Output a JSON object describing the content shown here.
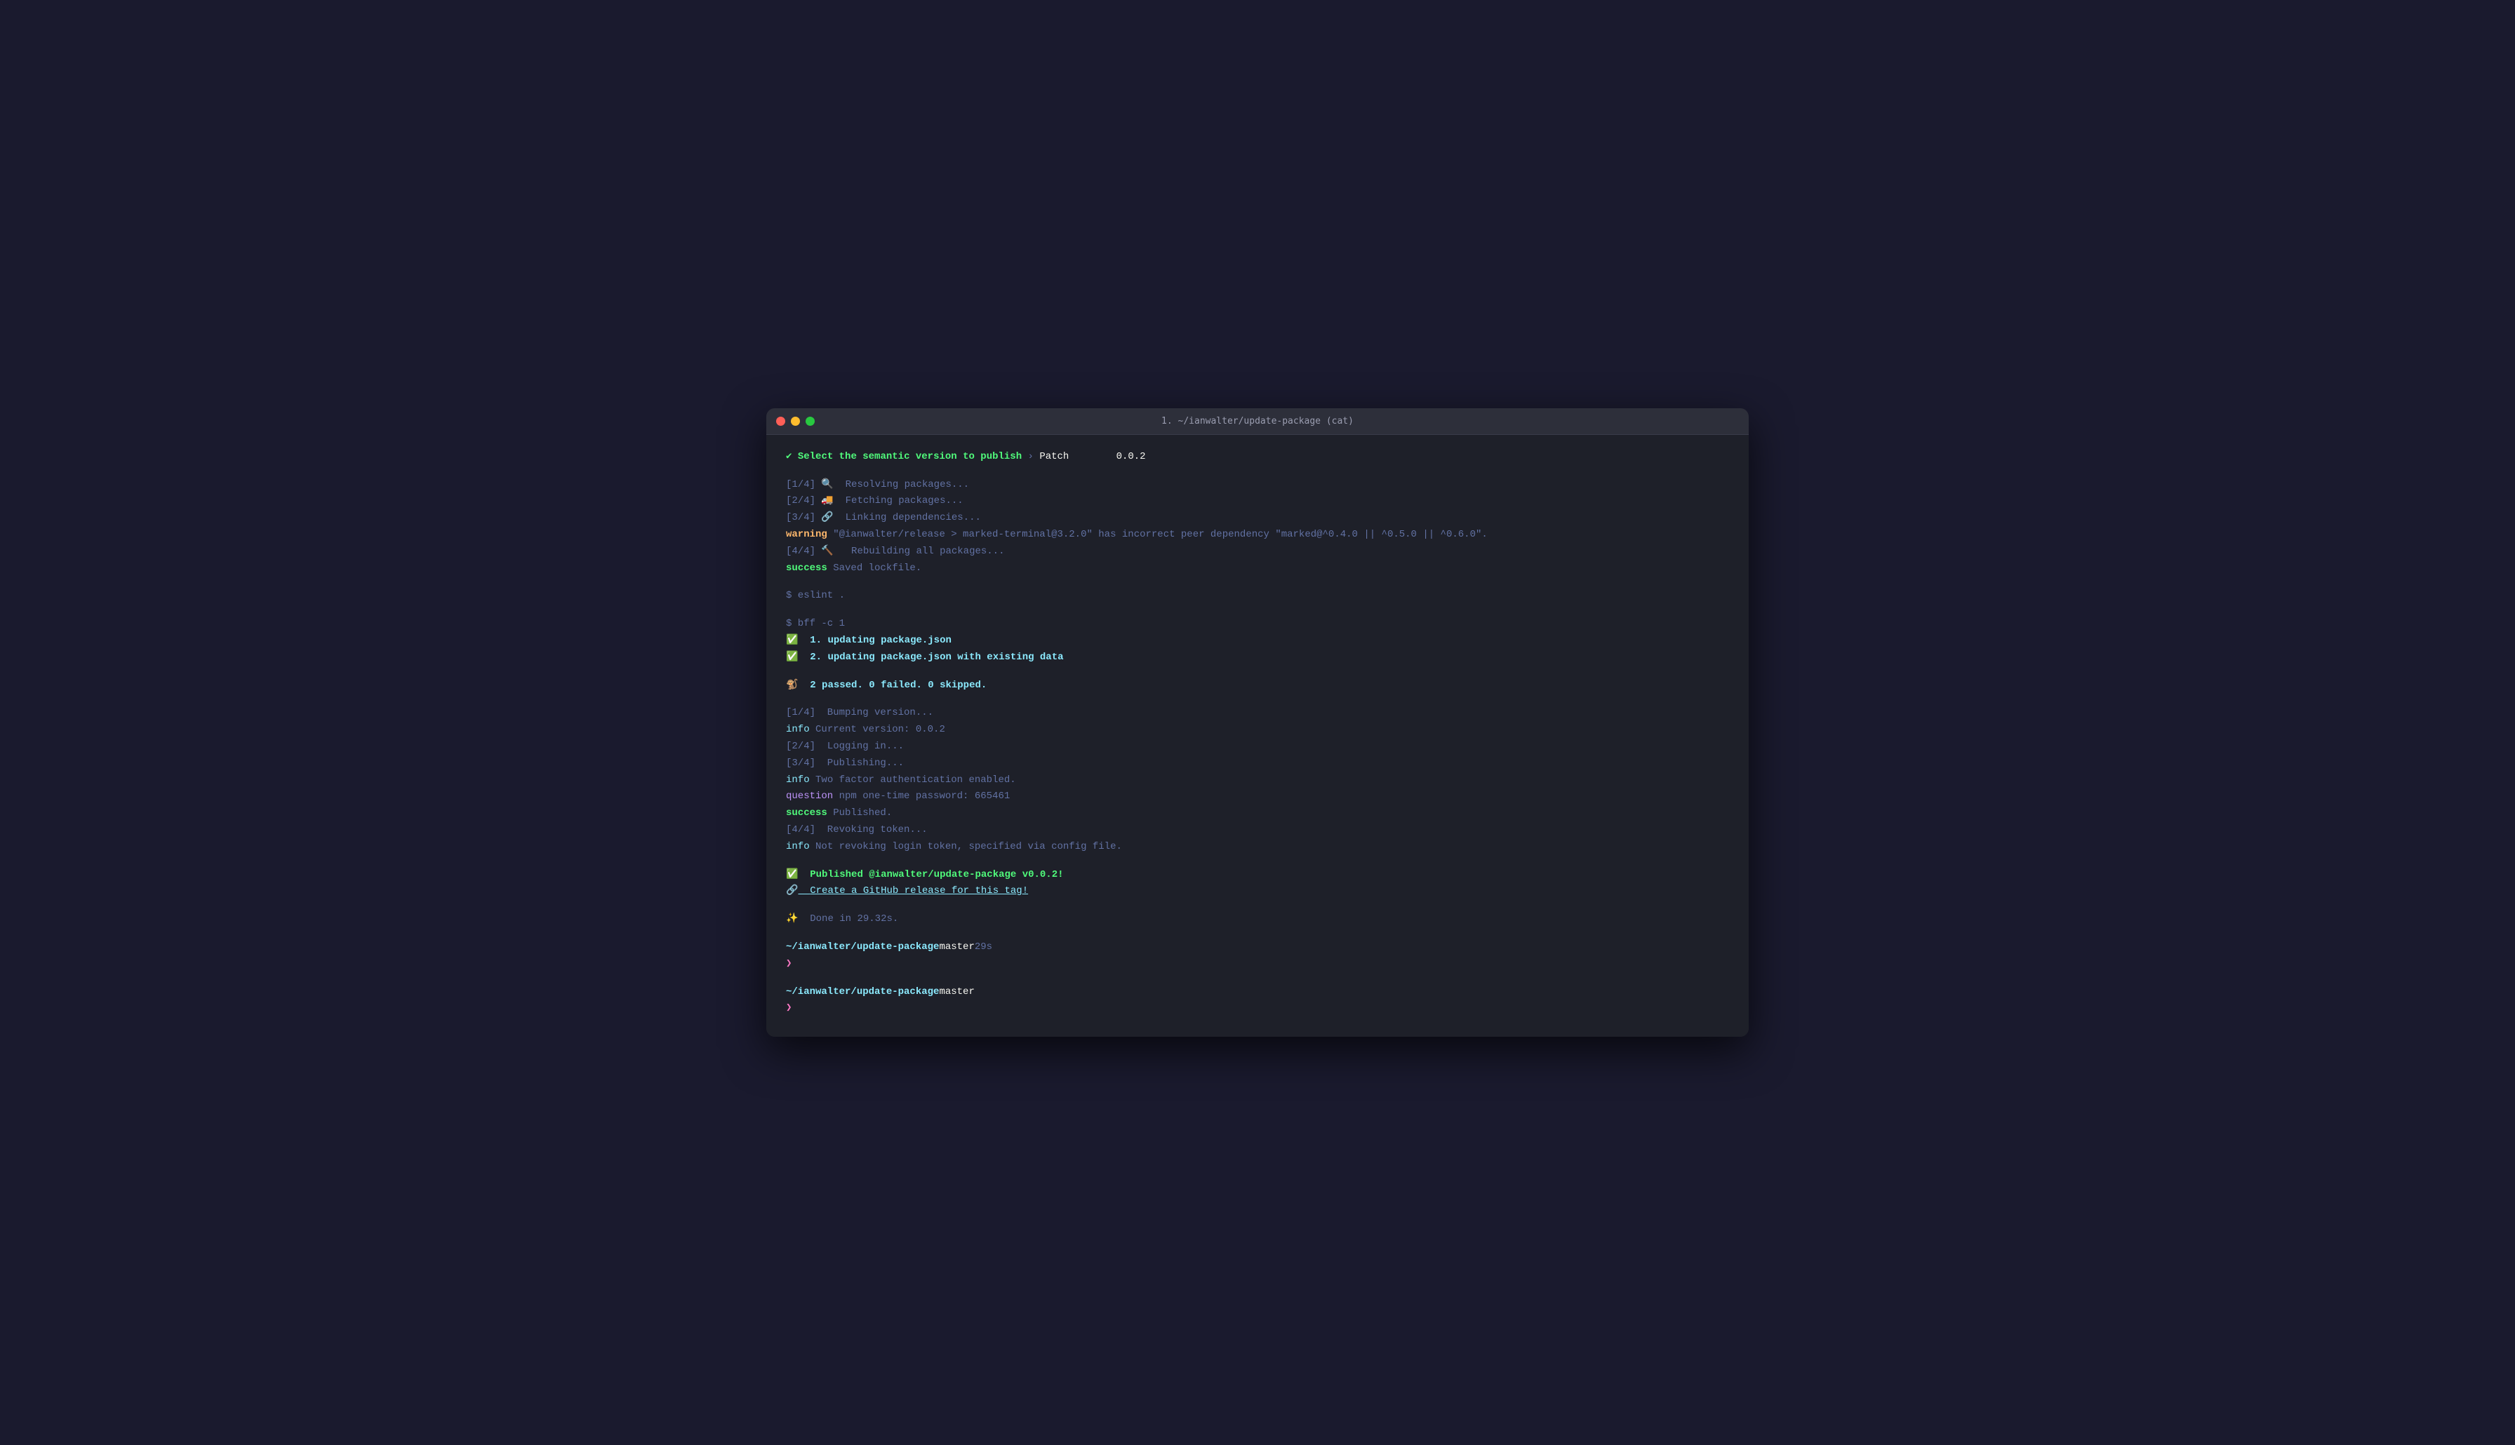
{
  "window": {
    "title": "1. ~/ianwalter/update-package (cat)"
  },
  "terminal": {
    "line1_check": "✔",
    "line1_text": " Select the semantic version to publish",
    "line1_arrow": "›",
    "line1_patch": "Patch",
    "line1_version": "0.0.2",
    "step1": "[1/4] 🔍  Resolving packages...",
    "step2": "[2/4] 🚚  Fetching packages...",
    "step3": "[3/4] 🔗  Linking dependencies...",
    "warning_label": "warning",
    "warning_text": " \"@ianwalter/release > marked-terminal@3.2.0\" has incorrect peer dependency \"marked@^0.4.0 || ^0.5.0 || ^0.6.0\".",
    "step4": "[4/4] 🔨   Rebuilding all packages...",
    "success1_label": "success",
    "success1_text": " Saved lockfile.",
    "cmd1": "$ eslint .",
    "cmd2": "$ bff -c 1",
    "task1_check": "✅",
    "task1_text": "  1. updating package.json",
    "task2_check": "✅",
    "task2_text": "  2. updating package.json with existing data",
    "result_emoji": "🐒",
    "result_text": "  2 passed. 0 failed. 0 skipped.",
    "bump1": "[1/4]  Bumping version...",
    "info1_label": "info",
    "info1_text": " Current version: 0.0.2",
    "bump2": "[2/4]  Logging in...",
    "bump3": "[3/4]  Publishing...",
    "info2_label": "info",
    "info2_text": " Two factor authentication enabled.",
    "question_label": "question",
    "question_text": " npm one-time password: 665461",
    "success2_label": "success",
    "success2_text": " Published.",
    "bump4": "[4/4]  Revoking token...",
    "info3_label": "info",
    "info3_text": " Not revoking login token, specified via config file.",
    "published_check": "✅",
    "published_text": "  Published @ianwalter/update-package v0.0.2!",
    "link_emoji": "🔗",
    "link_text": "  Create a GitHub release for this tag!",
    "done_sparkle": "✨",
    "done_text": "  Done in 29.32s.",
    "prompt1_path": "~/ianwalter/update-package",
    "prompt1_branch": " master",
    "prompt1_time": " 29s",
    "prompt2_path": "~/ianwalter/update-package",
    "prompt2_branch": " master"
  },
  "colors": {
    "green": "#50fa7b",
    "cyan": "#8be9fd",
    "bg": "#1e2029",
    "titlebar": "#2d2f3a"
  }
}
